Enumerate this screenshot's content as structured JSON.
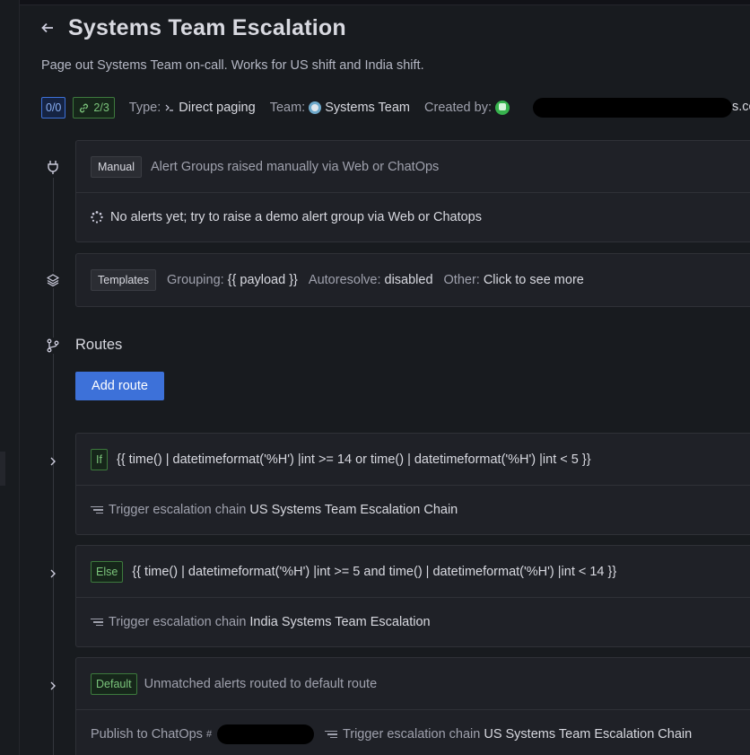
{
  "header": {
    "title": "Systems Team Escalation",
    "description": "Page out Systems Team on-call. Works for US shift and India shift."
  },
  "meta": {
    "alerts_badge": "0/0",
    "connections_badge": "2/3",
    "type_label": "Type:",
    "type_value": "Direct paging",
    "team_label": "Team:",
    "team_value": "Systems Team",
    "created_label": "Created by:",
    "created_tail": "s.co"
  },
  "manual_card": {
    "tag": "Manual",
    "description": "Alert Groups raised manually via Web or ChatOps",
    "status": "No alerts yet;  try to raise a demo alert group via Web or Chatops"
  },
  "templates_card": {
    "tag": "Templates",
    "grouping_label": "Grouping:",
    "grouping_value": "{{ payload }}",
    "autoresolve_label": "Autoresolve:",
    "autoresolve_value": "disabled",
    "other_label": "Other:",
    "other_value": "Click to see more"
  },
  "routes": {
    "title": "Routes",
    "add_button": "Add route",
    "trigger_label": "Trigger escalation chain",
    "publish_label": "Publish to ChatOps",
    "items": [
      {
        "tag": "If",
        "condition": "{{ time() | datetimeformat('%H') |int >= 14 or time() | datetimeformat('%H') |int < 5 }}",
        "chain": "US Systems Team Escalation Chain"
      },
      {
        "tag": "Else",
        "condition": "{{ time() | datetimeformat('%H') |int >= 5 and time() | datetimeformat('%H') |int < 14 }}",
        "chain": "India Systems Team Escalation"
      },
      {
        "tag": "Default",
        "condition": "Unmatched alerts routed to default route",
        "chain": "US Systems Team Escalation Chain"
      }
    ]
  },
  "colors": {
    "accent": "#3d71d9",
    "success": "#7bc47b",
    "background": "#181b1f"
  },
  "icons": [
    "back-arrow-icon",
    "link-icon",
    "type-icon",
    "team-icon",
    "plug-icon",
    "layers-icon",
    "branch-icon",
    "chevron-right-icon",
    "list-icon",
    "slack-icon",
    "spinner-icon"
  ]
}
